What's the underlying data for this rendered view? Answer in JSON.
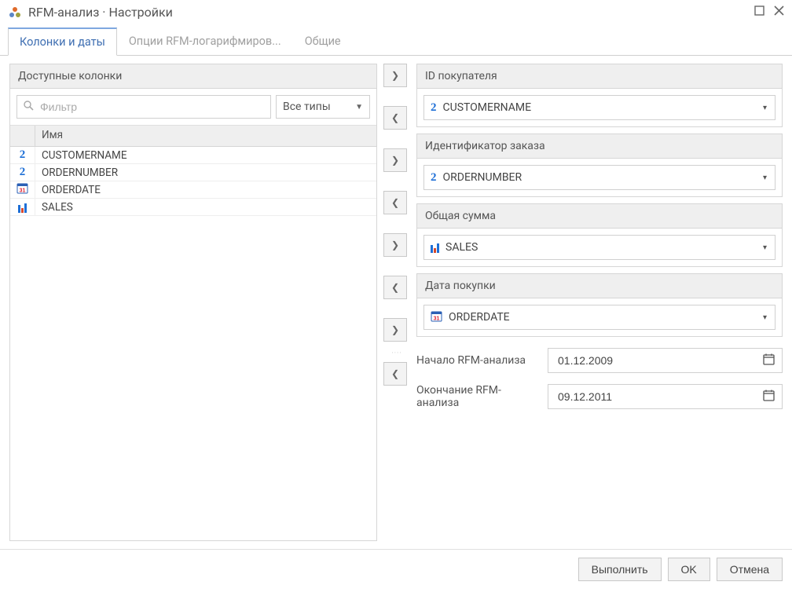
{
  "window": {
    "title": "RFM-анализ · Настройки"
  },
  "tabs": [
    {
      "label": "Колонки и даты",
      "active": true
    },
    {
      "label": "Опции RFM-логарифмиров...",
      "active": false
    },
    {
      "label": "Общие",
      "active": false
    }
  ],
  "leftPane": {
    "title": "Доступные колонки",
    "filter_placeholder": "Фильтр",
    "type_select_label": "Все типы",
    "header_name": "Имя",
    "rows": [
      {
        "icon": "num2",
        "name": "CUSTOMERNAME"
      },
      {
        "icon": "num2",
        "name": "ORDERNUMBER"
      },
      {
        "icon": "date",
        "name": "ORDERDATE"
      },
      {
        "icon": "bars",
        "name": "SALES"
      }
    ]
  },
  "fields": {
    "customer": {
      "title": "ID покупателя",
      "value": "CUSTOMERNAME",
      "icon": "num2"
    },
    "order": {
      "title": "Идентификатор заказа",
      "value": "ORDERNUMBER",
      "icon": "num2"
    },
    "amount": {
      "title": "Общая сумма",
      "value": "SALES",
      "icon": "bars"
    },
    "date": {
      "title": "Дата покупки",
      "value": "ORDERDATE",
      "icon": "date"
    }
  },
  "dates": {
    "start_label": "Начало RFM-анализа",
    "start_value": "01.12.2009",
    "end_label": "Окончание RFM-анализа",
    "end_value": "09.12.2011"
  },
  "footer": {
    "execute": "Выполнить",
    "ok": "OK",
    "cancel": "Отмена"
  }
}
